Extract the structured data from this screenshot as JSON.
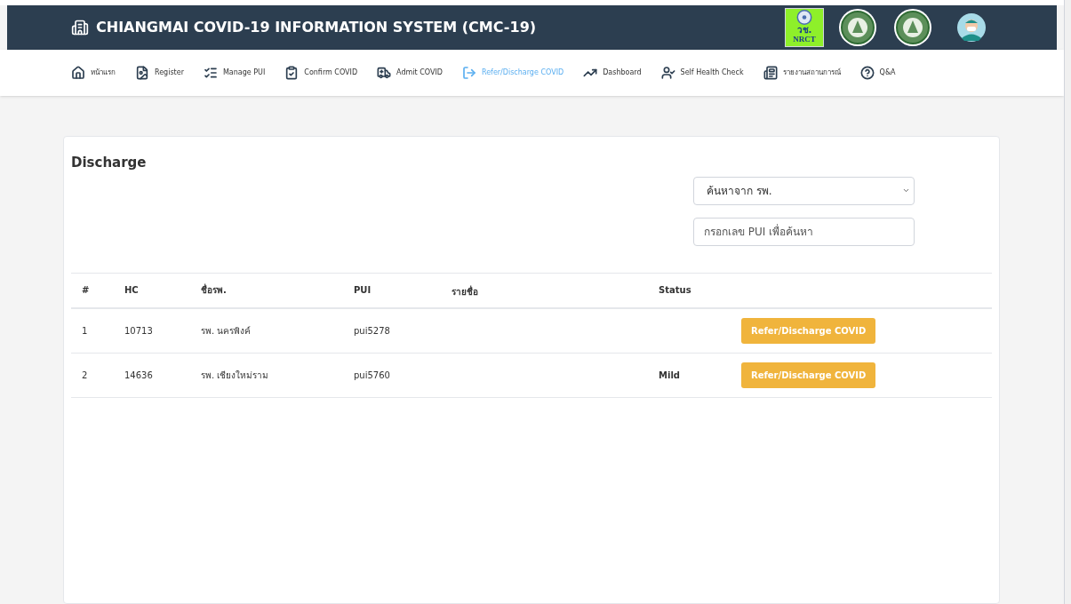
{
  "header": {
    "title": "CHIANGMAI COVID-19 INFORMATION SYSTEM (CMC-19)",
    "logos": [
      {
        "kind": "nrct",
        "text": "วช.",
        "caption": "NRCT"
      },
      {
        "kind": "seal"
      },
      {
        "kind": "seal"
      },
      {
        "kind": "avatar"
      }
    ]
  },
  "nav": [
    {
      "label": "หน้าแรก",
      "selected": false
    },
    {
      "label": "Register",
      "selected": false
    },
    {
      "label": "Manage PUI",
      "selected": false
    },
    {
      "label": "Confirm COVID",
      "selected": false
    },
    {
      "label": "Admit COVID",
      "selected": false
    },
    {
      "label": "Refer/Discharge COVID",
      "selected": true
    },
    {
      "label": "Dashboard",
      "selected": false
    },
    {
      "label": "Self Health Check",
      "selected": false
    },
    {
      "label": "รายงานสถานการณ์",
      "selected": false
    },
    {
      "label": "Q&A",
      "selected": false
    }
  ],
  "card": {
    "title": "Discharge",
    "hospital_select": {
      "value": "ค้นหาจาก รพ."
    },
    "pui_search": {
      "placeholder": "กรอกเลข PUI เพื่อค้นหา"
    }
  },
  "table": {
    "columns": [
      "#",
      "HC",
      "ชื่อรพ.",
      "PUI",
      "รายชื่อ",
      "Status"
    ],
    "rows": [
      {
        "cells": [
          "1",
          "10713",
          "รพ. นครพิงค์",
          "pui5278"
        ],
        "action": "Refer/Discharge COVID"
      },
      {
        "cells": [
          "2",
          "14636",
          "รพ. เชียงใหม่ราม",
          "pui5760"
        ],
        "status": "Mild",
        "action": "Refer/Discharge COVID"
      }
    ]
  }
}
